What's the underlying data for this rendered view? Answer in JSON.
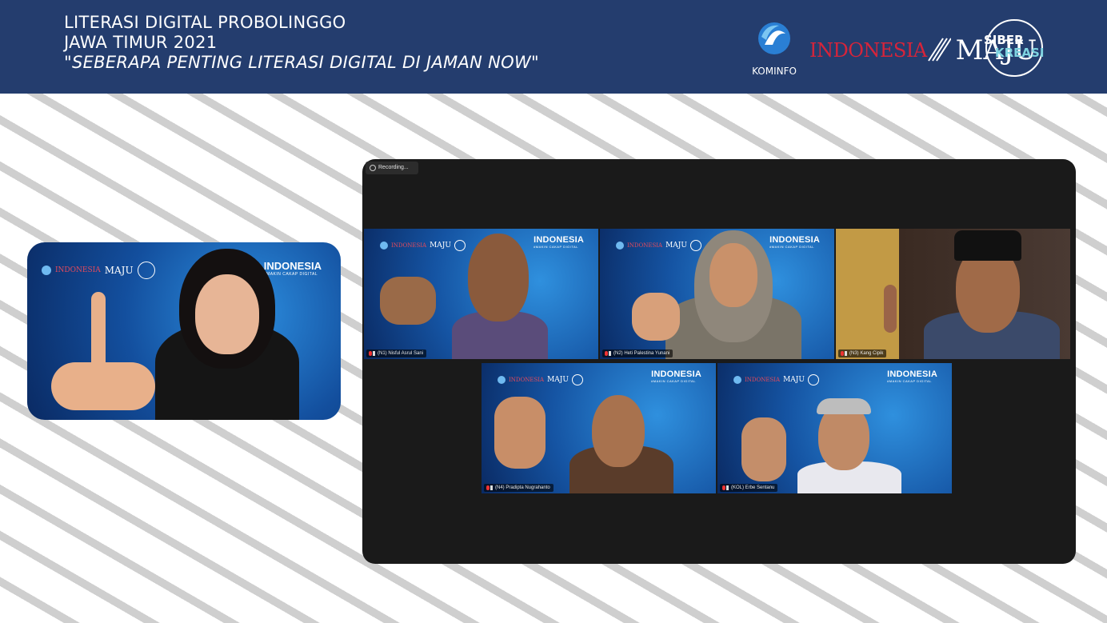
{
  "header": {
    "title_line1": "LITERASI DIGITAL PROBOLINGGO",
    "title_line2": "JAWA TIMUR 2021",
    "subtitle": "\"SEBERAPA PENTING LITERASI DIGITAL DI JAMAN NOW\"",
    "background_color": "#243d6e",
    "logos": {
      "kominfo_label": "KOMINFO",
      "indonesia_word": "INDONESIA",
      "maju_word": "MAJU",
      "siber_word": "SIBER",
      "kreasi_word": "KREASI"
    }
  },
  "host": {
    "brand_title": "INDONESIA",
    "brand_tagline": "#MAKIN CAKAP DIGITAL",
    "logo_indonesia": "INDONESIA",
    "logo_maju": "MAJU"
  },
  "zoom": {
    "recording_label": "Recording...",
    "tile_brand_title": "INDONESIA",
    "tile_brand_tagline": "#MAKIN CAKAP DIGITAL",
    "tile_logo_indonesia": "INDONESIA",
    "tile_logo_maju": "MAJU",
    "participants": [
      {
        "name": "(N1) Nisful Asrul Sani"
      },
      {
        "name": "(N2) Heti Palestina Yunani"
      },
      {
        "name": "(N3) Kang Cipik"
      },
      {
        "name": "(N4) Pradipta Nugrahanto"
      },
      {
        "name": "(KOL) Erbe Sentanu"
      }
    ]
  }
}
